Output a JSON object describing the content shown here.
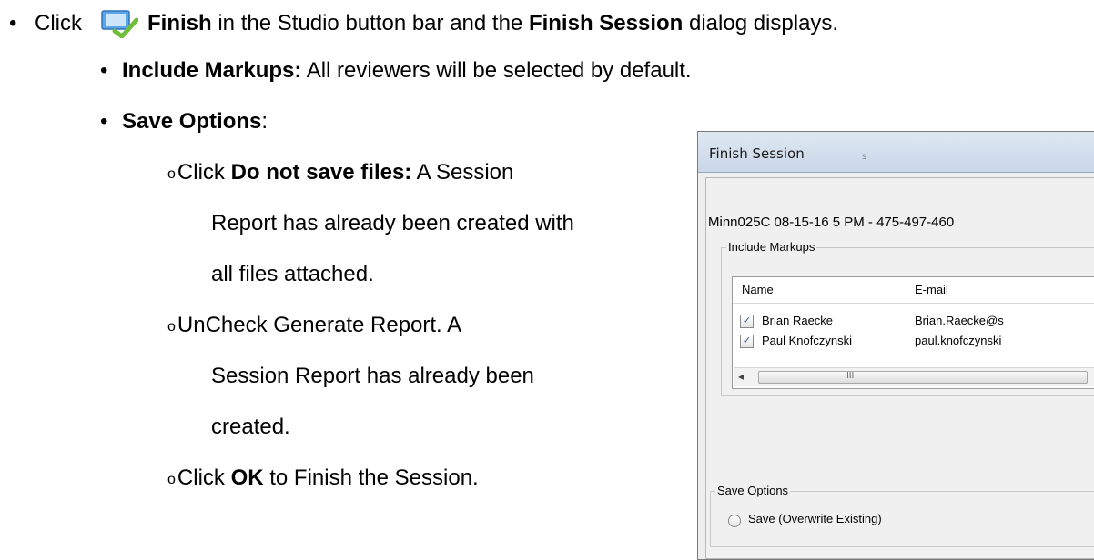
{
  "instructions": {
    "step1": {
      "bullet": "•",
      "prefix": "Click",
      "icon": "finish-icon",
      "bold1": "Finish",
      "mid": "in the Studio button bar and the",
      "bold2": "Finish Session",
      "suffix": "dialog displays."
    },
    "include_markups": {
      "bullet": "•",
      "label": "Include Markups:",
      "text": "All reviewers will be selected by default."
    },
    "save_options": {
      "bullet": "•",
      "label": "Save Options",
      "colon": ":"
    },
    "sub1": {
      "bullet": "o",
      "prefix": "Click",
      "bold": "Do not save files:",
      "line1_rest": "A Session",
      "line2": "Report has already been created with",
      "line3": "all files attached."
    },
    "sub2": {
      "bullet": "o",
      "line1": "UnCheck Generate Report. A",
      "line2": "Session Report has already been",
      "line3": "created."
    },
    "sub3": {
      "bullet": "o",
      "prefix": "Click",
      "bold": "OK",
      "suffix": "to Finish the Session."
    }
  },
  "dialog": {
    "title": "Finish Session",
    "smudge": "s",
    "session_name": "Minn025C 08-15-16 5 PM - 475-497-460",
    "include_markups_label": "Include Markups",
    "columns": [
      "Name",
      "E-mail"
    ],
    "reviewers": [
      {
        "checked": true,
        "check": "✓",
        "name": "Brian Raecke",
        "email": "Brian.Raecke@s"
      },
      {
        "checked": true,
        "check": "✓",
        "name": "Paul Knofczynski",
        "email": "paul.knofczynski"
      }
    ],
    "scroll_left": "◂",
    "scroll_grip": "III",
    "save_options_label": "Save Options",
    "save_option_1": "Save (Overwrite Existing)"
  },
  "colors": {
    "text": "#000000",
    "dialog_bg": "#f0f0f0",
    "titlebar": "#c9d7e8",
    "icon_blue": "#3d8fd8",
    "icon_green": "#6fbe3a"
  }
}
